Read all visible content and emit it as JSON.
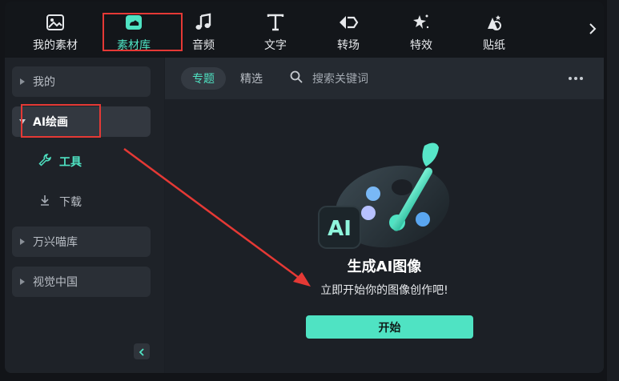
{
  "toolbar": {
    "items": [
      {
        "label": "我的素材",
        "icon": "my-media-icon"
      },
      {
        "label": "素材库",
        "icon": "library-icon"
      },
      {
        "label": "音频",
        "icon": "music-note-icon"
      },
      {
        "label": "文字",
        "icon": "text-icon"
      },
      {
        "label": "转场",
        "icon": "transition-icon"
      },
      {
        "label": "特效",
        "icon": "effects-icon"
      },
      {
        "label": "贴纸",
        "icon": "sticker-icon"
      }
    ],
    "active": "素材库",
    "more_icon": "chevron-right-icon"
  },
  "sidebar": {
    "items": [
      {
        "label": "我的"
      },
      {
        "label": "AI绘画"
      },
      {
        "label": "万兴喵库"
      },
      {
        "label": "视觉中国"
      }
    ],
    "sub_items": [
      {
        "label": "工具",
        "icon": "wrench-icon"
      },
      {
        "label": "下载",
        "icon": "download-icon"
      }
    ],
    "collapse_icon": "chevron-left-icon"
  },
  "main": {
    "tabs": [
      {
        "label": "专题"
      },
      {
        "label": "精选"
      }
    ],
    "search": {
      "placeholder": "搜索关键词"
    },
    "hero": {
      "badge_text": "AI",
      "title": "生成AI图像",
      "subtitle": "立即开始你的图像创作吧!",
      "button": "开始"
    }
  },
  "colors": {
    "accent": "#4fe3c3",
    "highlight": "#e53935",
    "background": "#1b1f25"
  }
}
